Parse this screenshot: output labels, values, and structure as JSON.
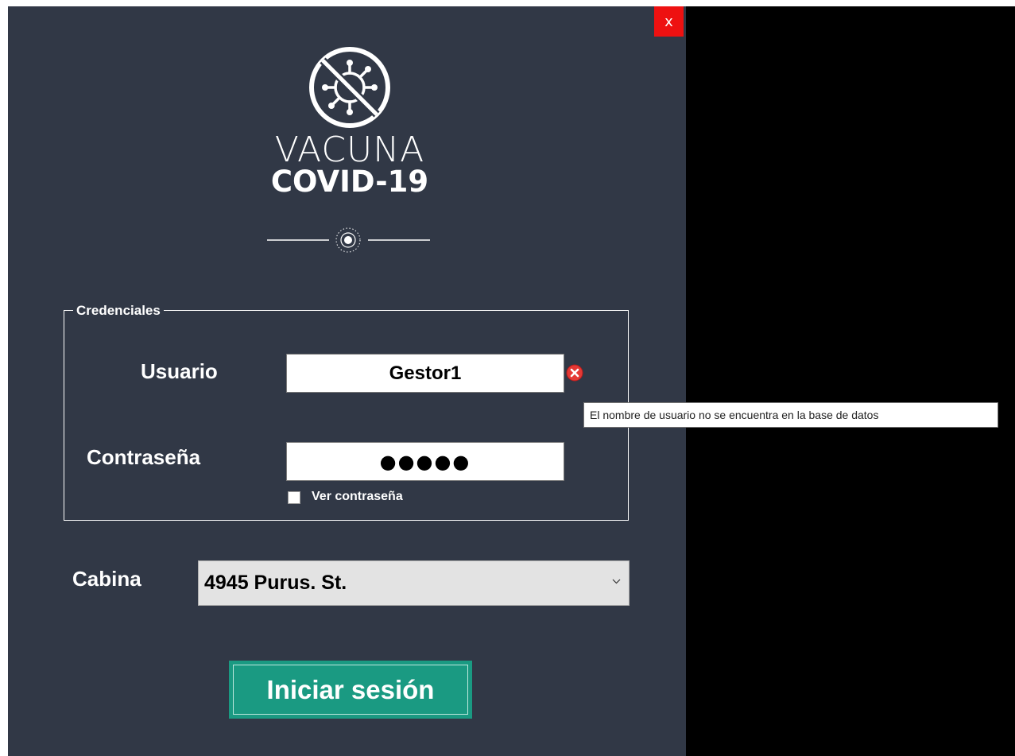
{
  "window": {
    "close_label": "x"
  },
  "logo": {
    "line1": "VACUNA",
    "line2": "COVID-19"
  },
  "credentials": {
    "legend": "Credenciales",
    "usuario_label": "Usuario",
    "usuario_value": "Gestor1",
    "contrasena_label": "Contraseña",
    "contrasena_value": "●●●●●",
    "show_password_label": "Ver contraseña",
    "show_password_checked": false,
    "error_tooltip": "El nombre de usuario no se encuentra en la base de datos"
  },
  "cabina": {
    "label": "Cabina",
    "selected": "4945 Purus. St."
  },
  "login_button": {
    "label": "Iniciar sesión"
  },
  "colors": {
    "window_bg": "#313846",
    "accent": "#1a9a82",
    "close": "#ee1111",
    "error": "#e53935"
  },
  "icons": {
    "logo": "virus-crossed-icon",
    "seal": "national-seal-icon",
    "error": "error-circle-icon",
    "dropdown": "chevron-down-icon"
  }
}
